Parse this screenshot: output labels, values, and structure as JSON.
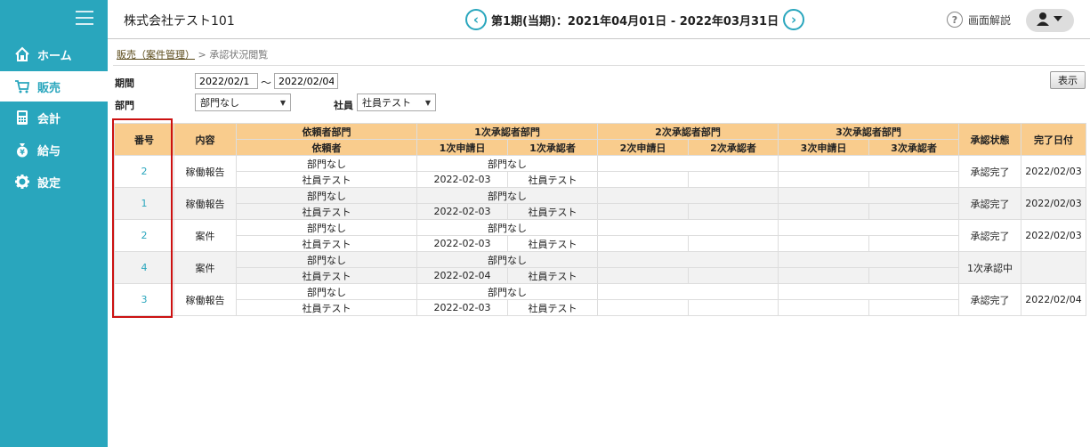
{
  "sidebar": {
    "items": [
      {
        "label": "ホーム",
        "icon": "home-icon"
      },
      {
        "label": "販売",
        "icon": "cart-icon"
      },
      {
        "label": "会計",
        "icon": "calculator-icon"
      },
      {
        "label": "給与",
        "icon": "money-bag-icon"
      },
      {
        "label": "設定",
        "icon": "gear-icon"
      }
    ],
    "active_index": 1,
    "color": "#29a6bd"
  },
  "header": {
    "company": "株式会社テスト101",
    "period": "第1期(当期)：2021年04月01日 - 2022年03月31日",
    "help": "画面解説"
  },
  "breadcrumb": {
    "parent": "販売（案件管理）",
    "separator": ">",
    "current": "承認状況閲覧"
  },
  "filters": {
    "period_label": "期間",
    "date_from": "2022/02/1",
    "tilde": "～",
    "date_to": "2022/02/04",
    "dept_label": "部門",
    "dept_value": "部門なし",
    "employee_label": "社員",
    "employee_value": "社員テスト",
    "show_button": "表示"
  },
  "table": {
    "headers": {
      "number": "番号",
      "content": "内容",
      "req_dept": "依頼者部門",
      "requester": "依頼者",
      "a1_dept": "1次承認者部門",
      "a1_date": "1次申請日",
      "a1_person": "1次承認者",
      "a2_dept": "2次承認者部門",
      "a2_date": "2次申請日",
      "a2_person": "2次承認者",
      "a3_dept": "3次承認者部門",
      "a3_date": "3次申請日",
      "a3_person": "3次承認者",
      "status": "承認状態",
      "done_date": "完了日付"
    },
    "rows": [
      {
        "number": "2",
        "content": "稼働報告",
        "req_dept": "部門なし",
        "a1_dept": "部門なし",
        "requester": "社員テスト",
        "a1_date": "2022-02-03",
        "a1_person": "社員テスト",
        "status": "承認完了",
        "done_date": "2022/02/03"
      },
      {
        "number": "1",
        "content": "稼働報告",
        "req_dept": "部門なし",
        "a1_dept": "部門なし",
        "requester": "社員テスト",
        "a1_date": "2022-02-03",
        "a1_person": "社員テスト",
        "status": "承認完了",
        "done_date": "2022/02/03"
      },
      {
        "number": "2",
        "content": "案件",
        "req_dept": "部門なし",
        "a1_dept": "部門なし",
        "requester": "社員テスト",
        "a1_date": "2022-02-03",
        "a1_person": "社員テスト",
        "status": "承認完了",
        "done_date": "2022/02/03"
      },
      {
        "number": "4",
        "content": "案件",
        "req_dept": "部門なし",
        "a1_dept": "部門なし",
        "requester": "社員テスト",
        "a1_date": "2022-02-04",
        "a1_person": "社員テスト",
        "status": "1次承認中",
        "done_date": ""
      },
      {
        "number": "3",
        "content": "稼働報告",
        "req_dept": "部門なし",
        "a1_dept": "部門なし",
        "requester": "社員テスト",
        "a1_date": "2022-02-03",
        "a1_person": "社員テスト",
        "status": "承認完了",
        "done_date": "2022/02/04"
      }
    ]
  },
  "highlight_color": "#cc1111",
  "header_color": "#f9cc8d"
}
